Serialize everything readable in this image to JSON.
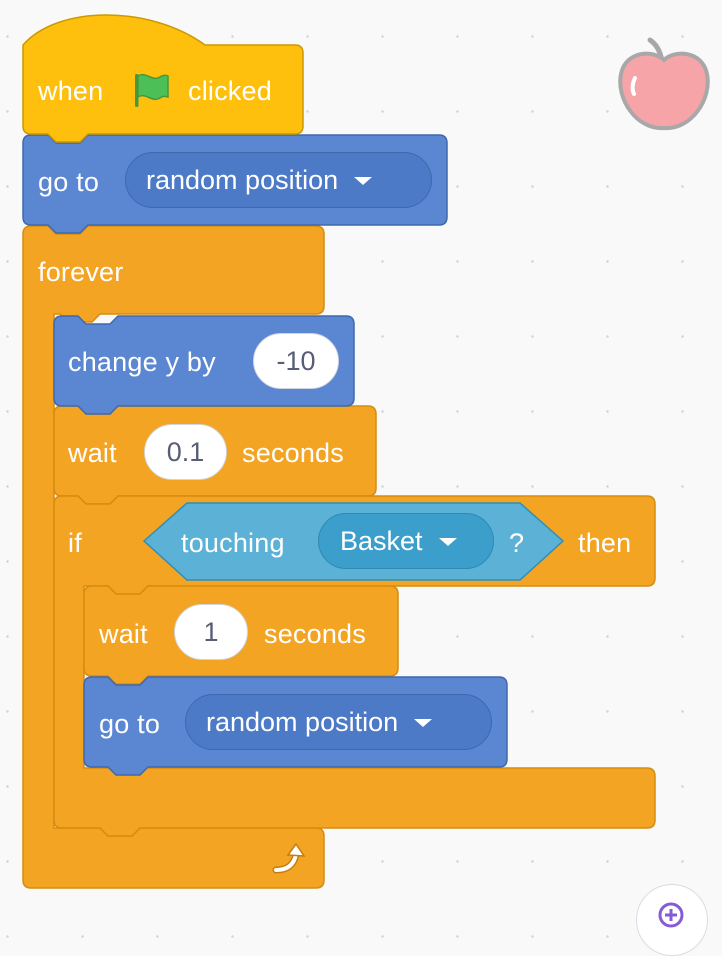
{
  "script": {
    "hat_when": "when",
    "hat_clicked": "clicked",
    "goto1_label": "go to",
    "goto1_menu": "random position",
    "forever_label": "forever",
    "change_y_label": "change y by",
    "change_y_value": "-10",
    "wait1_label": "wait",
    "wait1_value": "0.1",
    "wait1_unit": "seconds",
    "if_label": "if",
    "touching_label": "touching",
    "touching_menu": "Basket",
    "touching_q": "?",
    "then_label": "then",
    "wait2_label": "wait",
    "wait2_value": "1",
    "wait2_unit": "seconds",
    "goto2_label": "go to",
    "goto2_menu": "random position"
  },
  "icons": {
    "flag": "green-flag-icon",
    "loop_arrow": "loop-arrow-icon",
    "sprite": "apple-sprite-icon",
    "zoom": "zoom-in-icon"
  },
  "colors": {
    "events": "#ffbf00",
    "motion": "#4c97ff",
    "control": "#ffab19",
    "sensing": "#5cb1d6"
  }
}
